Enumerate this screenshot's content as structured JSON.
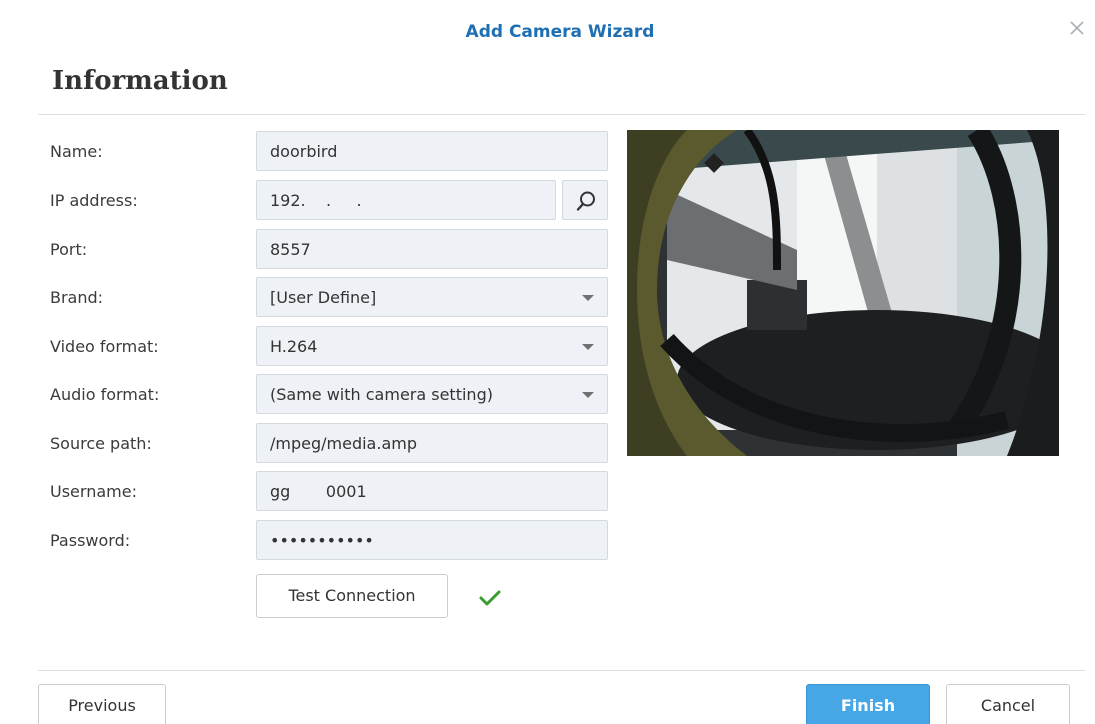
{
  "window": {
    "title": "Add Camera Wizard"
  },
  "section": {
    "heading": "Information"
  },
  "form": {
    "name": {
      "label": "Name:",
      "value": "doorbird"
    },
    "ip_address": {
      "label": "IP address:",
      "value": "192.    .     ."
    },
    "port": {
      "label": "Port:",
      "value": "8557"
    },
    "brand": {
      "label": "Brand:",
      "value": "[User Define]"
    },
    "video_format": {
      "label": "Video format:",
      "value": "H.264"
    },
    "audio_format": {
      "label": "Audio format:",
      "value": "(Same with camera setting)"
    },
    "source_path": {
      "label": "Source path:",
      "value": "/mpeg/media.amp"
    },
    "username": {
      "label": "Username:",
      "value": "gg       0001"
    },
    "password": {
      "label": "Password:",
      "value": "•••••••••••"
    }
  },
  "buttons": {
    "test_connection": "Test Connection",
    "previous": "Previous",
    "finish": "Finish",
    "cancel": "Cancel"
  },
  "status": {
    "connection_ok": true
  },
  "icons": {
    "close": "close-icon",
    "search": "search-icon",
    "success": "checkmark-icon",
    "dropdown": "chevron-down-icon"
  },
  "colors": {
    "title": "#1f6fb3",
    "primary_button": "#46a6e6",
    "success": "#3a9b2f",
    "field_background": "#eef2f6"
  }
}
